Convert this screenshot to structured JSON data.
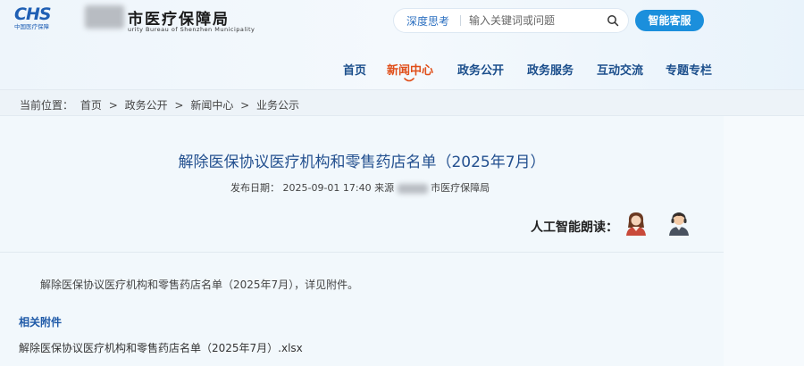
{
  "header": {
    "logo_mark": "CHS",
    "logo_sub": "中国医疗保障",
    "site_name": "市医疗保障局",
    "site_sub": "urity Bureau of Shenzhen Municipality"
  },
  "search": {
    "mode_label": "深度思考",
    "placeholder": "输入关键词或问题"
  },
  "service_button": "智能客服",
  "nav": [
    {
      "label": "首页"
    },
    {
      "label": "新闻中心"
    },
    {
      "label": "政务公开"
    },
    {
      "label": "政务服务"
    },
    {
      "label": "互动交流"
    },
    {
      "label": "专题专栏"
    }
  ],
  "breadcrumb": {
    "prefix": "当前位置：",
    "items": [
      "首页",
      "政务公开",
      "新闻中心",
      "业务公示"
    ],
    "separator": ">"
  },
  "article": {
    "title": "解除医保协议医疗机构和零售药店名单（2025年7月）",
    "publish_label": "发布日期：",
    "publish_date": "2025-09-01 17:40",
    "source_label": "来源",
    "source": "市医疗保障局",
    "ai_read_label": "人工智能朗读：",
    "body": "解除医保协议医疗机构和零售药店名单（2025年7月），详见附件。",
    "attachments_heading": "相关附件",
    "attachments": [
      "解除医保协议医疗机构和零售药店名单（2025年7月）.xlsx"
    ]
  },
  "colors": {
    "accent": "#1b8fdc",
    "nav_text": "#1c4f8c",
    "nav_active": "#e04f1a",
    "title": "#23508f"
  },
  "icons": [
    "search-icon",
    "female-reader-avatar-icon",
    "male-reader-avatar-icon",
    "nav-active-indicator-icon"
  ]
}
